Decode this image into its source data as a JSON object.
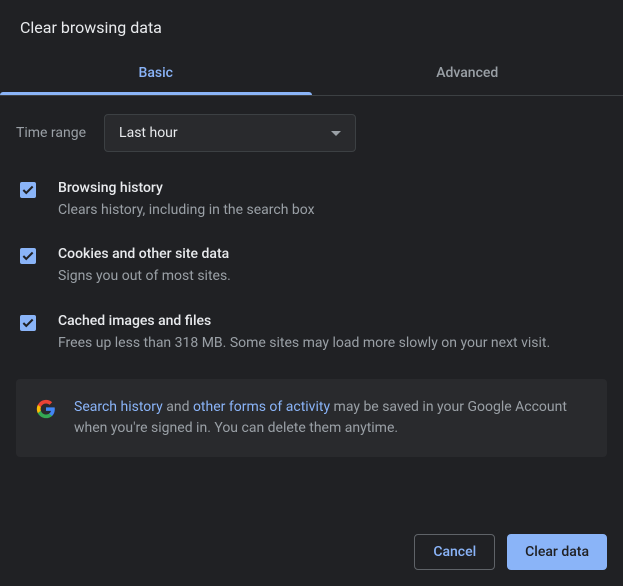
{
  "title": "Clear browsing data",
  "tabs": {
    "basic": "Basic",
    "advanced": "Advanced"
  },
  "timeRange": {
    "label": "Time range",
    "value": "Last hour"
  },
  "items": [
    {
      "title": "Browsing history",
      "description": "Clears history, including in the search box"
    },
    {
      "title": "Cookies and other site data",
      "description": "Signs you out of most sites."
    },
    {
      "title": "Cached images and files",
      "description": "Frees up less than 318 MB. Some sites may load more slowly on your next visit."
    }
  ],
  "info": {
    "link1": "Search history",
    "text1": " and ",
    "link2": "other forms of activity",
    "text2": " may be saved in your Google Account when you're signed in. You can delete them anytime."
  },
  "buttons": {
    "cancel": "Cancel",
    "clear": "Clear data"
  }
}
